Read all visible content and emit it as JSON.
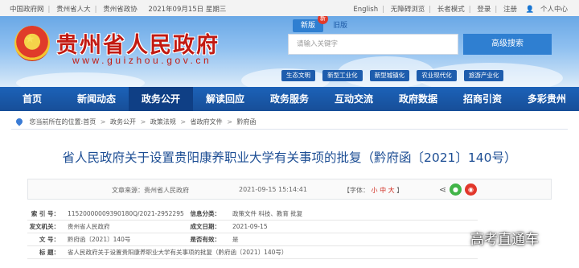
{
  "topbar": {
    "links": [
      "中国政府网",
      "贵州省人大",
      "贵州省政协"
    ],
    "date": "2021年09月15日  星期三",
    "right": [
      "English",
      "无障碍浏览",
      "长者模式",
      "登录",
      "注册"
    ],
    "user_center": "个人中心"
  },
  "header": {
    "site_name": "贵州省人民政府",
    "domain": "www.guizhou.gov.cn",
    "version_new": "新版",
    "version_new_badge": "新",
    "version_old": "旧版",
    "search_placeholder": "请输入关键字",
    "search_button": "高级搜索",
    "tags": [
      "生态文明",
      "新型工业化",
      "新型城镇化",
      "农业现代化",
      "旅游产业化"
    ]
  },
  "nav": {
    "items": [
      "首页",
      "新闻动态",
      "政务公开",
      "解读回应",
      "政务服务",
      "互动交流",
      "政府数据",
      "招商引资",
      "多彩贵州"
    ],
    "active": "政务公开"
  },
  "breadcrumb": {
    "items": [
      "您当前所在的位置:首页",
      "政务公开",
      "政策法规",
      "省政府文件",
      "黔府函"
    ]
  },
  "article": {
    "title": "省人民政府关于设置贵阳康养职业大学有关事项的批复（黔府函〔2021〕140号）",
    "source": "文章来源：贵州省人民政府",
    "date": "2021-09-15 15:14:41",
    "font_label": "【字体：",
    "font_small": "小",
    "font_medium": "中",
    "font_large": "大",
    "font_end": "】"
  },
  "info": {
    "index_label": "索  引  号：",
    "index_value": "11520000009390180Q/2021-2952295",
    "category_label": "信息分类：",
    "category_value": "政策文件  科技、教育  批复",
    "issuer_label": "发文机关：",
    "issuer_value": "贵州省人民政府",
    "date_label": "成文日期：",
    "date_value": "2021-09-15",
    "docno_label": "文      号：",
    "docno_value": "黔府函〔2021〕140号",
    "valid_label": "是否有效：",
    "valid_value": "是",
    "title_label": "标      题：",
    "title_value": "省人民政府关于设置贵阳康养职业大学有关事项的批复（黔府函〔2021〕140号）"
  },
  "watermark": "高考直通车"
}
